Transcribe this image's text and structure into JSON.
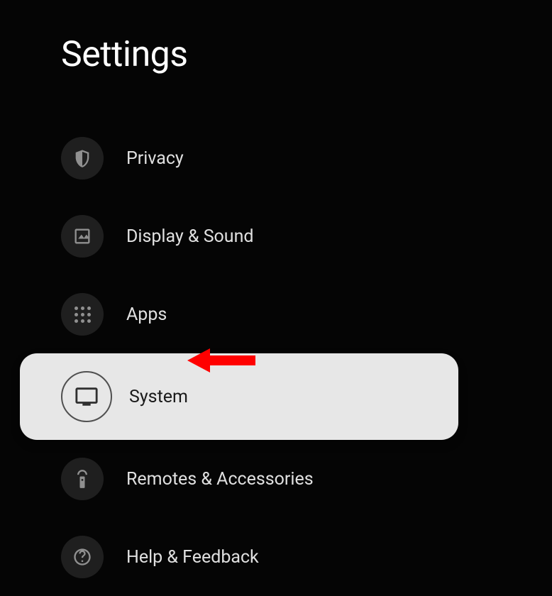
{
  "title": "Settings",
  "menu": {
    "items": [
      {
        "label": "Privacy",
        "icon": "shield-icon",
        "selected": false
      },
      {
        "label": "Display & Sound",
        "icon": "image-icon",
        "selected": false
      },
      {
        "label": "Apps",
        "icon": "apps-grid-icon",
        "selected": false
      },
      {
        "label": "System",
        "icon": "tv-icon",
        "selected": true
      },
      {
        "label": "Remotes & Accessories",
        "icon": "remote-icon",
        "selected": false
      },
      {
        "label": "Help & Feedback",
        "icon": "help-icon",
        "selected": false
      }
    ]
  },
  "annotation": {
    "type": "arrow",
    "color": "#ff0000",
    "points_to": "System"
  }
}
